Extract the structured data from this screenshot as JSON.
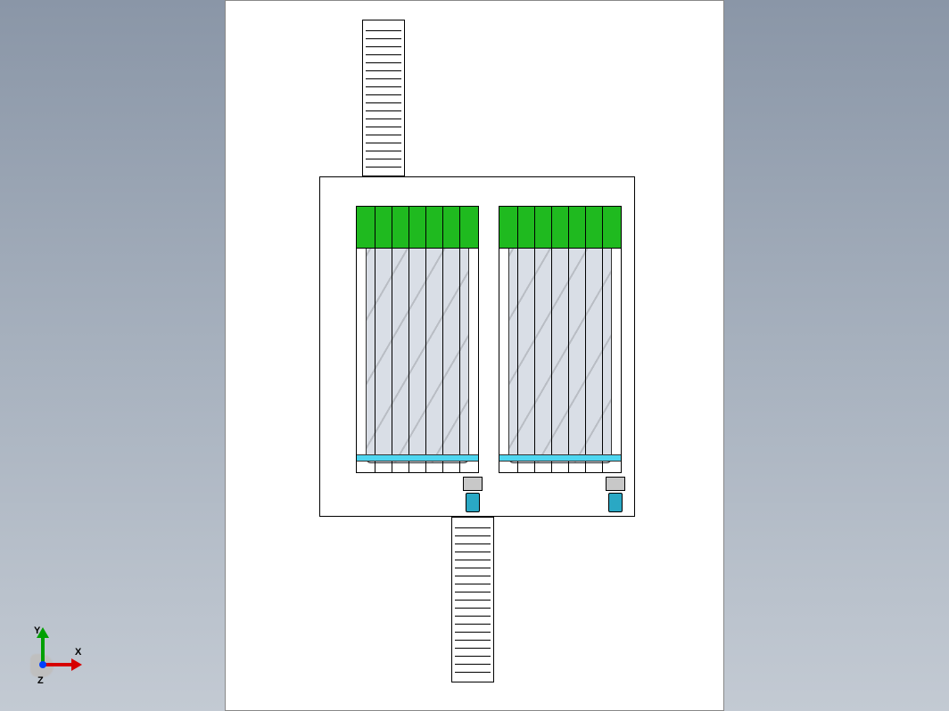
{
  "view": {
    "type": "3D CAD viewport",
    "projection": "top-down plan view",
    "background": "blue-grey gradient",
    "drawing_sheet": {
      "orientation": "portrait",
      "fill": "white"
    }
  },
  "coordinate_triad": {
    "x_label": "X",
    "y_label": "Y",
    "z_label": "Z",
    "x_color": "#d60000",
    "y_color": "#00a000",
    "z_color": "#0040ff"
  },
  "model": {
    "description": "Twin vertical spiral towers on a rectangular platform with inlet and outlet belt conveyors",
    "platform": {
      "shape": "rectangle",
      "openings": 2
    },
    "towers": [
      {
        "id": "tower-left",
        "color_accent": "green",
        "drum": "spiral cylinder",
        "drive_motor": "bottom-right of opening"
      },
      {
        "id": "tower-right",
        "color_accent": "green",
        "drum": "spiral cylinder",
        "drive_motor": "bottom-right of opening"
      }
    ],
    "conveyors": [
      {
        "id": "conveyor-top",
        "position": "above platform, left-of-centre",
        "type": "straight belt, ladder rungs"
      },
      {
        "id": "conveyor-bottom",
        "position": "below platform, centre",
        "type": "straight belt, ladder rungs"
      }
    ]
  }
}
